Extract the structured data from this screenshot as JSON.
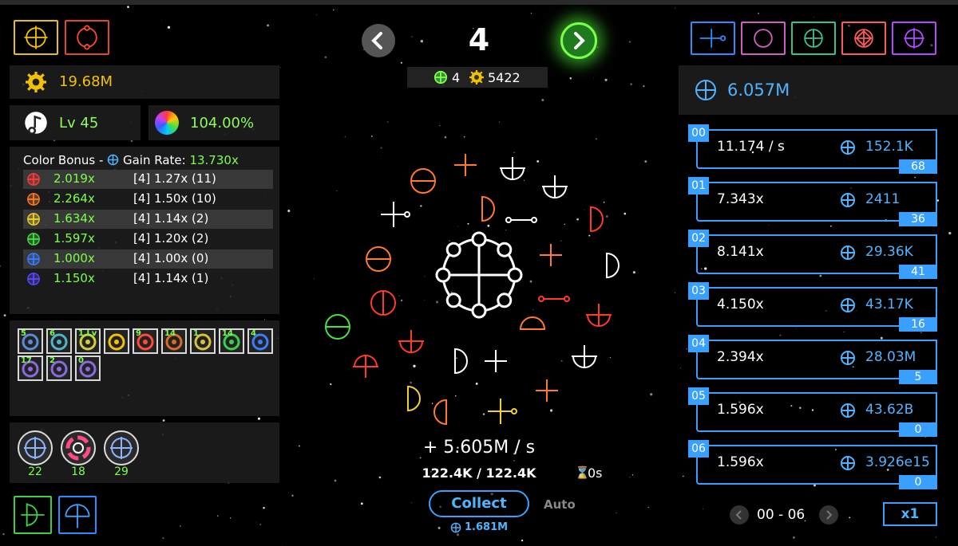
{
  "header": {
    "stage_number": "4",
    "stage_icon_count": "4",
    "stage_gear_count": "5422"
  },
  "resources": {
    "gear_amount": "19.68M",
    "level": "Lv 45",
    "color_percent": "104.00%",
    "right_total": "6.057M"
  },
  "color_bonus": {
    "title": "Color Bonus - ",
    "gain_label": "Gain Rate: ",
    "gain_value": "13.730x",
    "rows": [
      {
        "color": "#ff3b3b",
        "mult": "2.019x",
        "level": "[4] 1.27x (11)"
      },
      {
        "color": "#ff7a2a",
        "mult": "2.264x",
        "level": "[4] 1.50x (10)"
      },
      {
        "color": "#f2d22a",
        "mult": "1.634x",
        "level": "[4] 1.14x (2)"
      },
      {
        "color": "#44e044",
        "mult": "1.597x",
        "level": "[4] 1.20x (2)"
      },
      {
        "color": "#3a7cff",
        "mult": "1.000x",
        "level": "[4] 1.00x (0)"
      },
      {
        "color": "#5a4aff",
        "mult": "1.150x",
        "level": "[4] 1.14x (1)"
      }
    ]
  },
  "upgrades": {
    "tiles_row1": [
      "5",
      "6",
      "1 Lv",
      "",
      "9",
      "14",
      "1",
      "14",
      "4"
    ],
    "tiles_row2": [
      "17",
      "2",
      "0"
    ],
    "circles": [
      {
        "count": "22",
        "icon": "target-arrow-icon"
      },
      {
        "count": "18",
        "icon": "color-wheel-icon"
      },
      {
        "count": "29",
        "icon": "orbit-sigil-icon"
      }
    ]
  },
  "center": {
    "rate": "+ 5.605M / s",
    "capacity": "122.4K / 122.4K",
    "timer": "0s",
    "collect_label": "Collect",
    "auto_label": "Auto",
    "collect_amount": "1.681M"
  },
  "generators": [
    {
      "idx": "00",
      "rate": "11.174 / s",
      "cost": "152.1K",
      "count": "68"
    },
    {
      "idx": "01",
      "rate": "7.343x",
      "cost": "2411",
      "count": "36"
    },
    {
      "idx": "02",
      "rate": "8.141x",
      "cost": "29.36K",
      "count": "41"
    },
    {
      "idx": "03",
      "rate": "4.150x",
      "cost": "43.17K",
      "count": "16"
    },
    {
      "idx": "04",
      "rate": "2.394x",
      "cost": "28.03M",
      "count": "5"
    },
    {
      "idx": "05",
      "rate": "1.596x",
      "cost": "43.62B",
      "count": "0"
    },
    {
      "idx": "06",
      "rate": "1.596x",
      "cost": "3.926e15",
      "count": "0"
    }
  ],
  "pager": {
    "range": "00 - 06",
    "multiplier": "x1"
  },
  "colors": {
    "accent_blue": "#3aa0ff",
    "green_text": "#7cff4a",
    "gold": "#f2c200"
  }
}
